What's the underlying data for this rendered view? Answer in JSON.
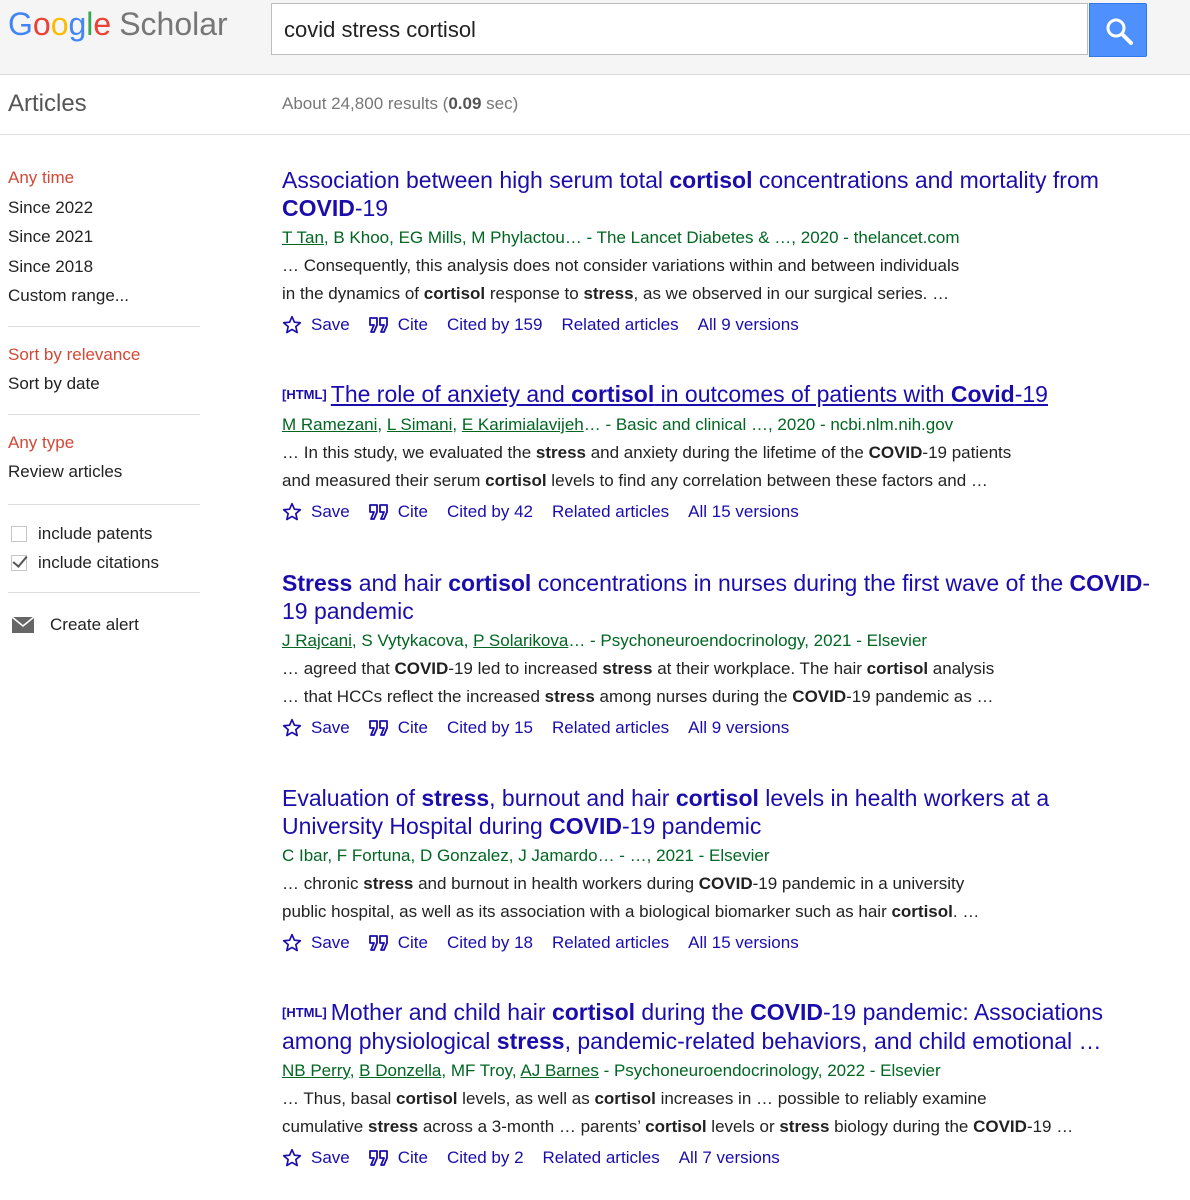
{
  "header": {
    "logo_g": "G",
    "logo_o1": "o",
    "logo_o2": "o",
    "logo_g2": "g",
    "logo_l": "l",
    "logo_e": "e",
    "logo_scholar": "Scholar",
    "search_value": "covid stress cortisol"
  },
  "subheader": {
    "section": "Articles",
    "results_prefix": "About 24,800 results (",
    "results_time": "0.09",
    "results_suffix": " sec)"
  },
  "sidebar": {
    "time_filters": [
      "Any time",
      "Since 2022",
      "Since 2021",
      "Since 2018",
      "Custom range..."
    ],
    "sort_options": [
      "Sort by relevance",
      "Sort by date"
    ],
    "type_filters": [
      "Any type",
      "Review articles"
    ],
    "include_patents": "include patents",
    "include_citations": "include citations",
    "create_alert": "Create alert"
  },
  "results": [
    {
      "title_parts": [
        "Association between high serum total ",
        "cortisol",
        " concentrations and mortality from ",
        "COVID",
        "-19"
      ],
      "authors": [
        "T Tan",
        ", B Khoo, EG Mills, M Phylactou… - The Lancet Diabetes & …, 2020 - thelancet.com"
      ],
      "snippet1": [
        "… Consequently, this analysis does not consider variations within and between individuals"
      ],
      "snippet2": [
        "in the dynamics of ",
        "cortisol",
        " response to ",
        "stress",
        ", as we observed in our surgical series. …"
      ],
      "save": "Save",
      "cite": "Cite",
      "cited_by": "Cited by 159",
      "related": "Related articles",
      "versions": "All 9 versions"
    },
    {
      "tag": "[HTML]",
      "title_parts": [
        "The role of anxiety and ",
        "cortisol",
        " in outcomes of patients with ",
        "Covid",
        "-19"
      ],
      "authors": [
        "M Ramezani",
        ", ",
        "L Simani",
        ", ",
        "E Karimialavijeh",
        "… - Basic and clinical …, 2020 - ncbi.nlm.nih.gov"
      ],
      "snippet1": [
        "… In this study, we evaluated the ",
        "stress",
        " and anxiety during the lifetime of the ",
        "COVID",
        "-19 patients"
      ],
      "snippet2": [
        "and measured their serum ",
        "cortisol",
        " levels to find any correlation between these factors and …"
      ],
      "save": "Save",
      "cite": "Cite",
      "cited_by": "Cited by 42",
      "related": "Related articles",
      "versions": "All 15 versions"
    },
    {
      "title_parts": [
        "Stress",
        " and hair ",
        "cortisol",
        " concentrations in nurses during the first wave of the ",
        "COVID",
        "-19 pandemic"
      ],
      "authors": [
        "J Rajcani",
        ", S Vytykacova, ",
        "P Solarikova",
        "… - Psychoneuroendocrinology, 2021 - Elsevier"
      ],
      "snippet1": [
        "… agreed that ",
        "COVID",
        "-19 led to increased ",
        "stress",
        " at their workplace. The hair ",
        "cortisol",
        " analysis"
      ],
      "snippet2": [
        "… that HCCs reflect the increased ",
        "stress",
        " among nurses during the ",
        "COVID",
        "-19 pandemic as …"
      ],
      "save": "Save",
      "cite": "Cite",
      "cited_by": "Cited by 15",
      "related": "Related articles",
      "versions": "All 9 versions"
    },
    {
      "title_parts": [
        "Evaluation of ",
        "stress",
        ", burnout and hair ",
        "cortisol",
        " levels in health workers at a University Hospital during ",
        "COVID",
        "-19 pandemic"
      ],
      "authors": [
        "C Ibar, F Fortuna, D Gonzalez, J Jamardo… - …, 2021 - Elsevier"
      ],
      "snippet1": [
        "… chronic ",
        "stress",
        " and burnout in health workers during ",
        "COVID",
        "-19 pandemic in a university"
      ],
      "snippet2": [
        "public hospital, as well as its association with a biological biomarker such as hair ",
        "cortisol",
        ". …"
      ],
      "save": "Save",
      "cite": "Cite",
      "cited_by": "Cited by 18",
      "related": "Related articles",
      "versions": "All 15 versions"
    },
    {
      "tag": "[HTML]",
      "title_parts": [
        "Mother and child hair ",
        "cortisol",
        " during the ",
        "COVID",
        "-19 pandemic: Associations among physiological ",
        "stress",
        ", pandemic-related behaviors, and child emotional …"
      ],
      "authors": [
        "NB Perry",
        ", ",
        "B Donzella",
        ", MF Troy, ",
        "AJ Barnes",
        " - Psychoneuroendocrinology, 2022 - Elsevier"
      ],
      "snippet1": [
        "… Thus, basal ",
        "cortisol",
        " levels, as well as ",
        "cortisol",
        " increases in … possible to reliably examine"
      ],
      "snippet2": [
        "cumulative ",
        "stress",
        " across a 3-month … parents’ ",
        "cortisol",
        " levels or ",
        "stress",
        " biology during the ",
        "COVID",
        "-19 …"
      ],
      "save": "Save",
      "cite": "Cite",
      "cited_by": "Cited by 2",
      "related": "Related articles",
      "versions": "All 7 versions"
    }
  ]
}
